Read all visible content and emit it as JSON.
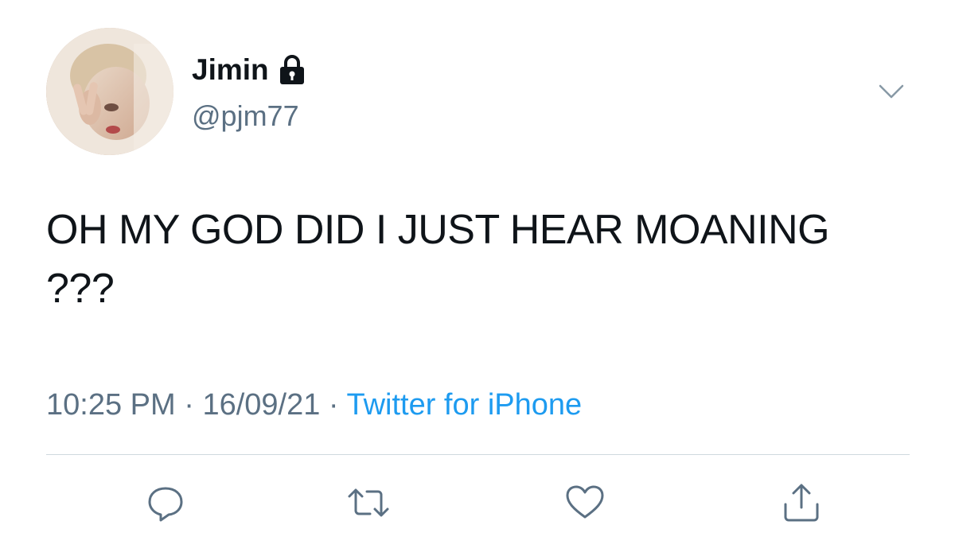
{
  "user": {
    "display_name": "Jimin",
    "handle": "@pjm77",
    "protected_icon": "lock-icon",
    "avatar": "profile-photo"
  },
  "tweet": {
    "text": "OH MY GOD DID I JUST HEAR MOANING ???",
    "time": "10:25 PM",
    "separator": "·",
    "date": "16/09/21",
    "source": "Twitter for iPhone"
  },
  "actions": [
    {
      "name": "reply",
      "icon": "reply-icon"
    },
    {
      "name": "retweet",
      "icon": "retweet-icon"
    },
    {
      "name": "like",
      "icon": "heart-icon"
    },
    {
      "name": "share",
      "icon": "share-icon"
    }
  ],
  "menu_icon": "chevron-down-icon",
  "colors": {
    "text": "#0f1419",
    "secondary": "#5b7083",
    "link": "#1d9bf0",
    "divider": "#cfd9de",
    "icon": "#5b7083"
  }
}
